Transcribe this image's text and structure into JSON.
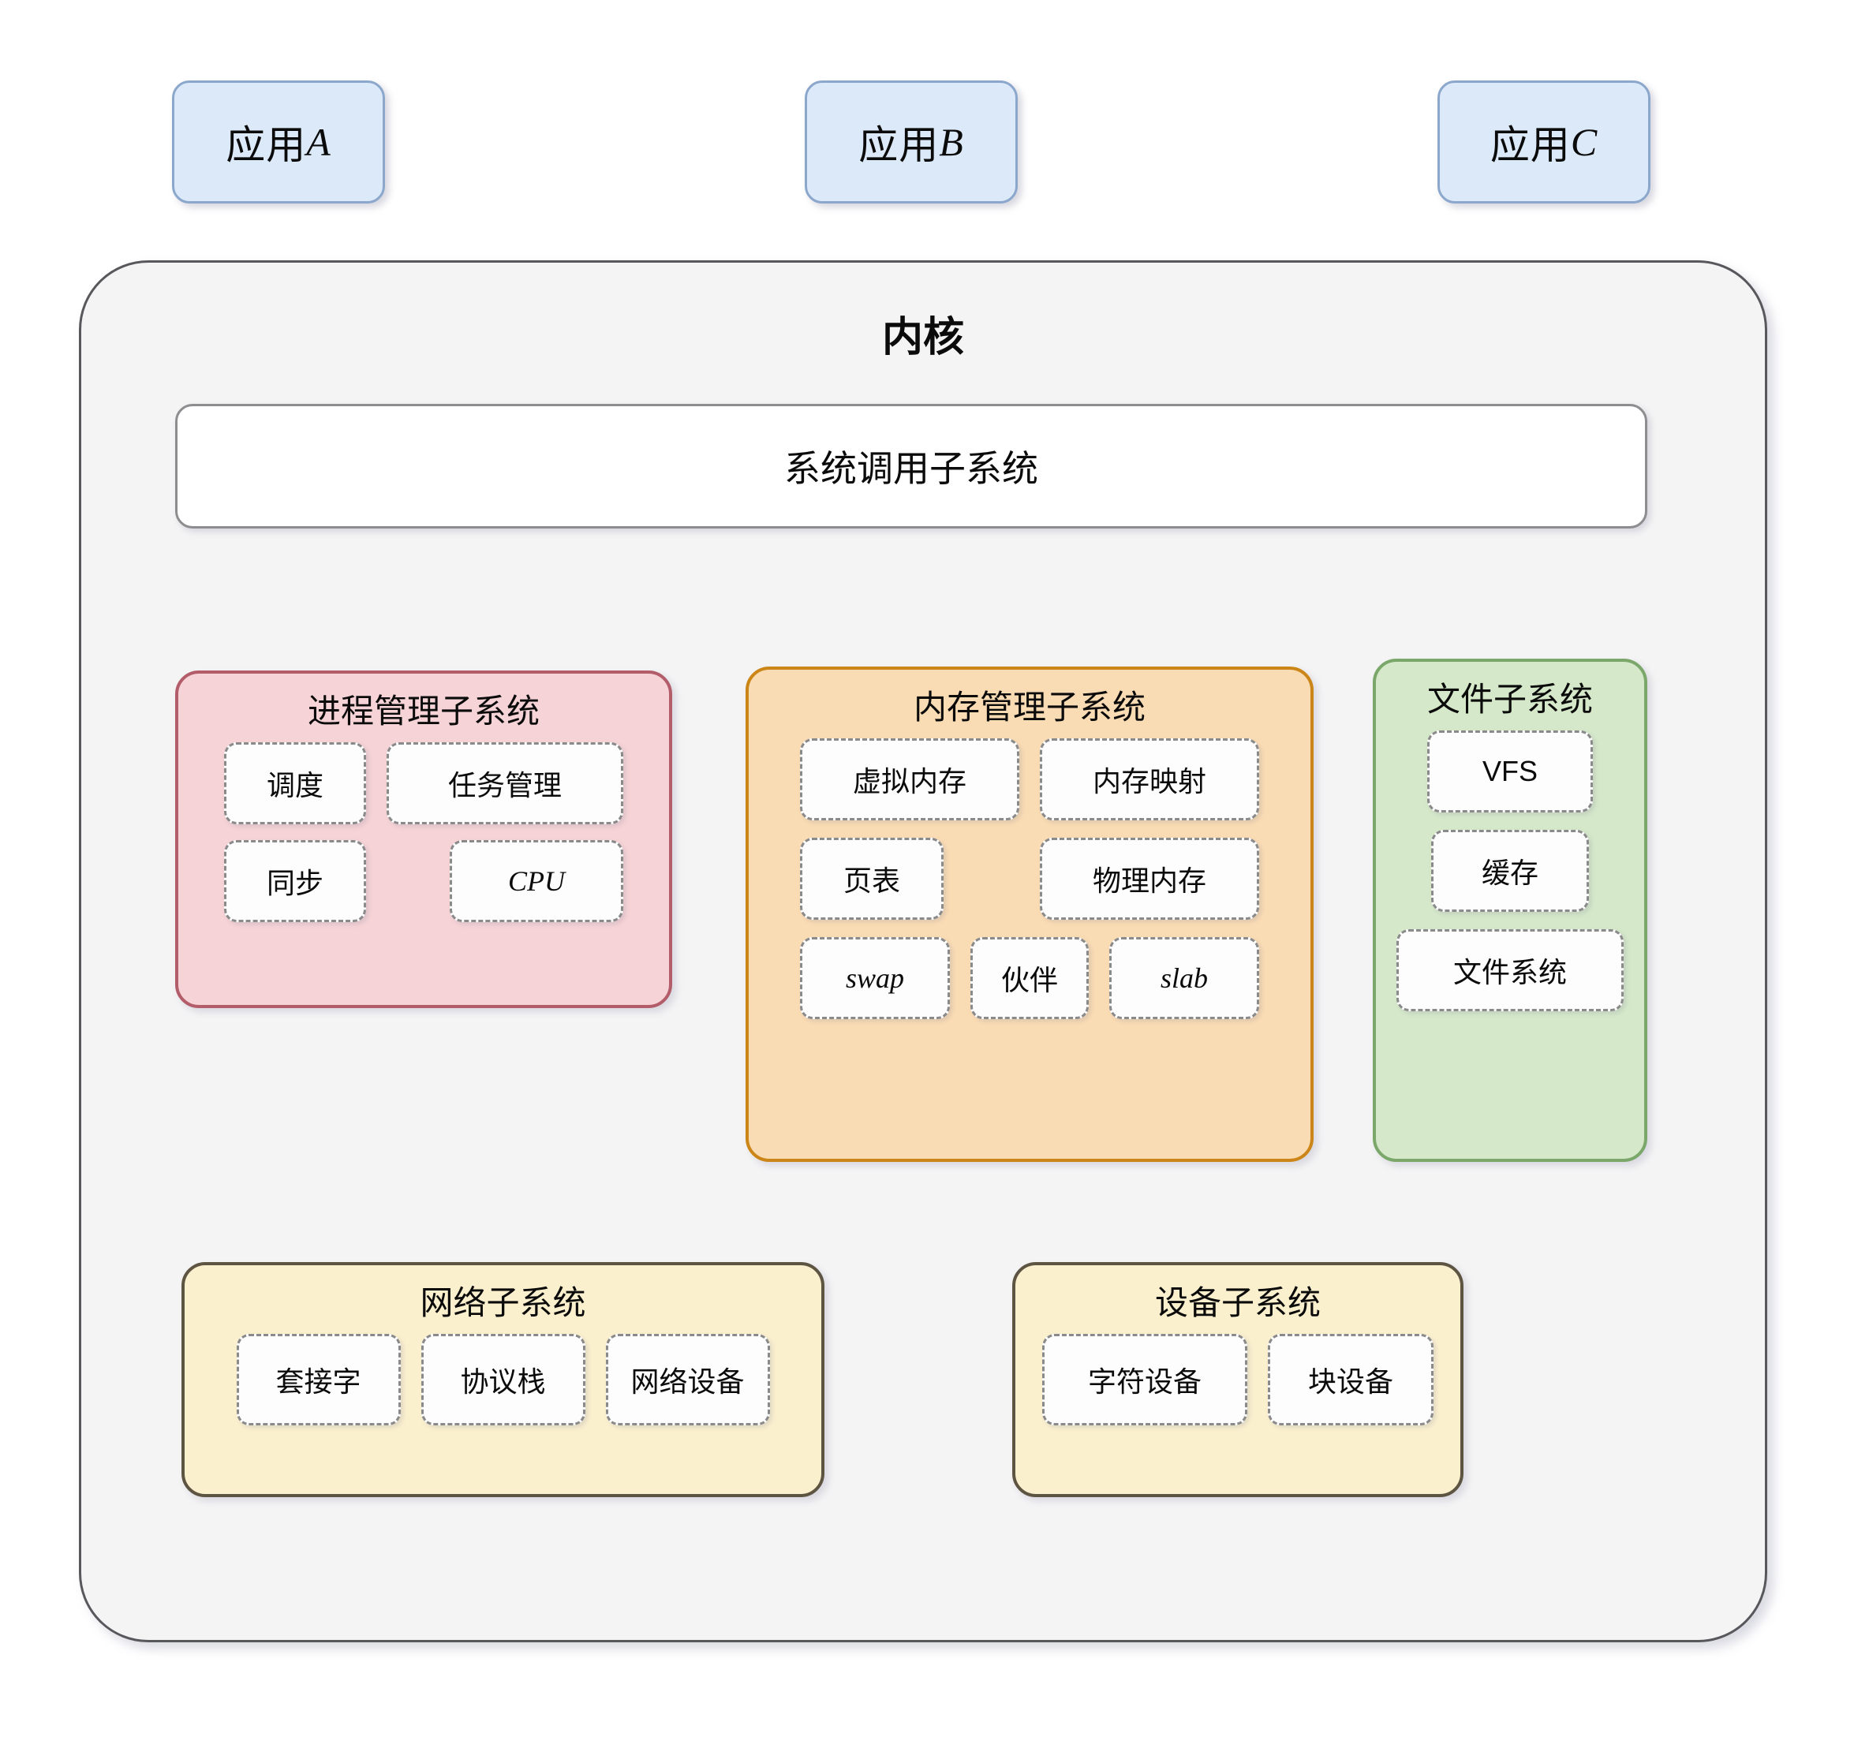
{
  "diagram": {
    "title": "内核",
    "apps": [
      {
        "label_cjk": "应用",
        "label_latin": "A"
      },
      {
        "label_cjk": "应用",
        "label_latin": "B"
      },
      {
        "label_cjk": "应用",
        "label_latin": "C"
      }
    ],
    "syscall": {
      "label": "系统调用子系统"
    },
    "groups": {
      "process": {
        "title": "进程管理子系统",
        "items": [
          "调度",
          "任务管理",
          "同步",
          "CPU"
        ],
        "fill": "#f6d3d6",
        "stroke": "#b35d6a"
      },
      "memory": {
        "title": "内存管理子系统",
        "items": [
          "虚拟内存",
          "内存映射",
          "页表",
          "物理内存",
          "swap",
          "伙伴",
          "slab"
        ],
        "fill": "#fadcb4",
        "stroke": "#cc8517"
      },
      "file": {
        "title": "文件子系统",
        "items": [
          "VFS",
          "缓存",
          "文件系统"
        ],
        "fill": "#d5e8c9",
        "stroke": "#7ba86a"
      },
      "network": {
        "title": "网络子系统",
        "items": [
          "套接字",
          "协议栈",
          "网络设备"
        ],
        "fill": "#fbf0ce",
        "stroke": "#5e5442"
      },
      "device": {
        "title": "设备子系统",
        "items": [
          "字符设备",
          "块设备"
        ],
        "fill": "#fbf0ce",
        "stroke": "#5e5442"
      }
    },
    "colors": {
      "app_fill": "#dce9f9",
      "app_stroke": "#8ba7cc",
      "kernel_fill": "#f4f4f5",
      "kernel_stroke": "#58585c",
      "leaf_fill": "#fdfdfd",
      "leaf_stroke": "#8a8a8a",
      "wire": "#9a9a9a",
      "page_background": "#ffffff"
    }
  }
}
